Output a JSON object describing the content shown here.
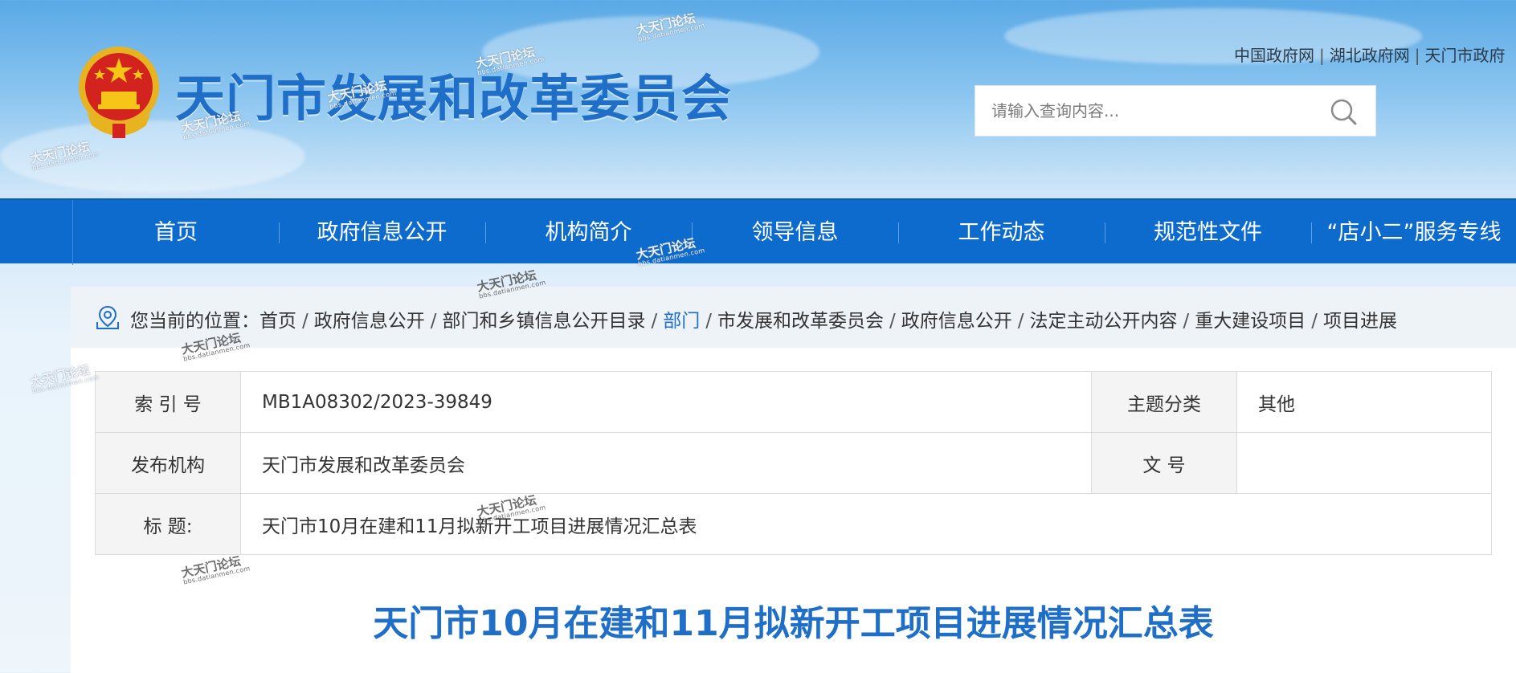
{
  "header": {
    "site_title": "天门市发展和改革委员会",
    "top_links": [
      "中国政府网",
      "湖北政府网",
      "天门市政府"
    ],
    "search_placeholder": "请输入查询内容..."
  },
  "nav": {
    "items": [
      "首页",
      "政府信息公开",
      "机构简介",
      "领导信息",
      "工作动态",
      "规范性文件",
      "“店小二”服务专线"
    ]
  },
  "breadcrumb": {
    "prefix": "您当前的位置：",
    "items": [
      "首页",
      "政府信息公开",
      "部门和乡镇信息公开目录",
      "部门",
      "市发展和改革委员会",
      "政府信息公开",
      "法定主动公开内容",
      "重大建设项目",
      "项目进展"
    ],
    "active_index": 3
  },
  "meta": {
    "index_label": "索 引 号",
    "index_value": "MB1A08302/2023-39849",
    "topic_label": "主题分类",
    "topic_value": "其他",
    "publisher_label": "发布机构",
    "publisher_value": "天门市发展和改革委员会",
    "docno_label": "文  号",
    "docno_value": "",
    "title_label": "标  题:",
    "title_value": "天门市10月在建和11月拟新开工项目进展情况汇总表"
  },
  "document": {
    "title": "天门市10月在建和11月拟新开工项目进展情况汇总表"
  },
  "watermark": {
    "text": "大天门论坛",
    "sub": "bbs.datianmen.com"
  },
  "colors": {
    "brand_blue": "#1f6ec7",
    "nav_blue": "#0d6bcd"
  }
}
